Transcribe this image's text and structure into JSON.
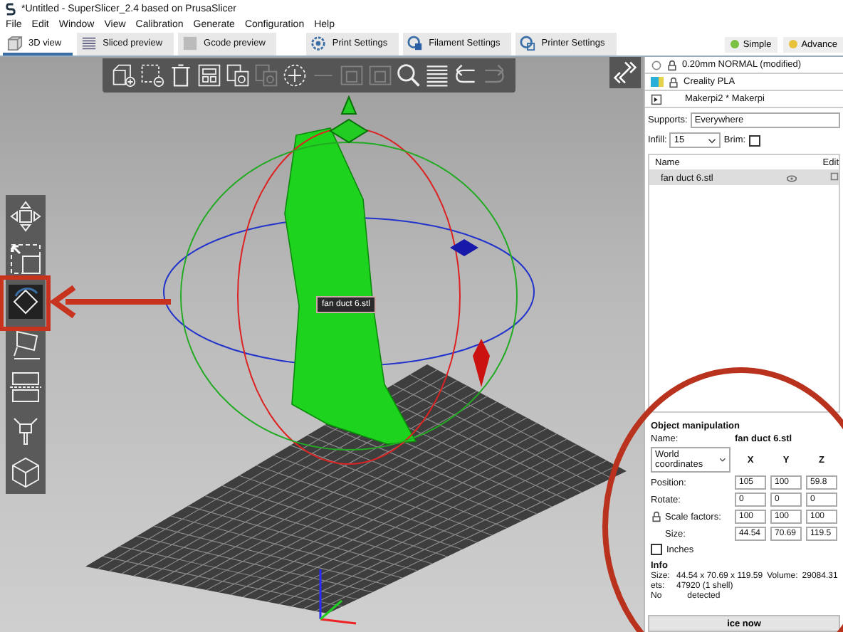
{
  "window": {
    "title": "*Untitled - SuperSlicer_2.4  based on PrusaSlicer"
  },
  "menu": [
    "File",
    "Edit",
    "Window",
    "View",
    "Calibration",
    "Generate",
    "Configuration",
    "Help"
  ],
  "tabs": [
    {
      "label": "3D view",
      "kind": "view",
      "selected": true
    },
    {
      "label": "Sliced preview",
      "kind": "layers",
      "selected": false
    },
    {
      "label": "Gcode preview",
      "kind": "gcode",
      "selected": false
    },
    {
      "label": "Print Settings",
      "kind": "print",
      "selected": false
    },
    {
      "label": "Filament Settings",
      "kind": "filament",
      "selected": false
    },
    {
      "label": "Printer Settings",
      "kind": "printer",
      "selected": false
    }
  ],
  "modes": [
    {
      "label": "Simple",
      "color": "#7ac142"
    },
    {
      "label": "Advance",
      "color": "#e8c23a"
    }
  ],
  "toolbar": [
    {
      "kind": "add",
      "disabled": false
    },
    {
      "kind": "delete",
      "disabled": false
    },
    {
      "kind": "delete-all",
      "disabled": false
    },
    {
      "kind": "arrange",
      "disabled": false
    },
    {
      "kind": "copy",
      "disabled": false
    },
    {
      "kind": "paste",
      "disabled": true
    },
    {
      "kind": "more",
      "disabled": false
    },
    {
      "kind": "fewer",
      "disabled": true
    },
    {
      "kind": "split",
      "disabled": true
    },
    {
      "kind": "split-parts",
      "disabled": true
    },
    {
      "kind": "search",
      "disabled": false
    },
    {
      "kind": "layers",
      "disabled": false
    },
    {
      "kind": "undo",
      "disabled": false
    },
    {
      "kind": "redo",
      "disabled": true
    }
  ],
  "side_tools": [
    {
      "kind": "move",
      "selected": false
    },
    {
      "kind": "scale",
      "selected": false
    },
    {
      "kind": "rotate",
      "selected": true
    },
    {
      "kind": "place",
      "selected": false
    },
    {
      "kind": "cut",
      "selected": false
    },
    {
      "kind": "paint",
      "selected": false
    },
    {
      "kind": "seam",
      "selected": false
    }
  ],
  "tooltip": "fan duct 6.stl",
  "presets": [
    {
      "kind": "print",
      "value": "0.20mm NORMAL (modified)"
    },
    {
      "kind": "filament",
      "value": "Creality PLA"
    },
    {
      "kind": "printer",
      "value": "Makerpi2 * Makerpi"
    }
  ],
  "supports": {
    "label": "Supports:",
    "value": "Everywhere"
  },
  "infill": {
    "label": "Infill:",
    "value": "15"
  },
  "brim": {
    "label": "Brim:",
    "checked": false
  },
  "object_list": {
    "columns": [
      "Name",
      "Edit"
    ],
    "rows": [
      {
        "name": "fan duct 6.stl",
        "selected": true
      }
    ]
  },
  "object_manipulation": {
    "title": "Object manipulation",
    "name_label": "Name:",
    "name_value": "fan duct 6.stl",
    "coordinates": "World coordinates",
    "axes": [
      "X",
      "Y",
      "Z"
    ],
    "rows": [
      {
        "label": "Position:",
        "values": [
          "105",
          "100",
          "59.8"
        ]
      },
      {
        "label": "Rotate:",
        "values": [
          "0",
          "0",
          "0"
        ]
      },
      {
        "label": "Scale factors:",
        "values": [
          "100",
          "100",
          "100"
        ]
      },
      {
        "label": "Size:",
        "values": [
          "44.54",
          "70.69",
          "119.5"
        ]
      }
    ],
    "inches": {
      "label": "Inches",
      "checked": false
    }
  },
  "info": {
    "title": "Info",
    "size_label": "Size:",
    "size_value": "44.54 x 70.69 x 119.59",
    "volume_label": "Volume:",
    "volume_value": "29084.31",
    "facets_label": "ets:",
    "facets_value": "47920 (1 shell)",
    "errors_start": "No",
    "errors_end": "detected"
  },
  "slice_button": "ice now"
}
